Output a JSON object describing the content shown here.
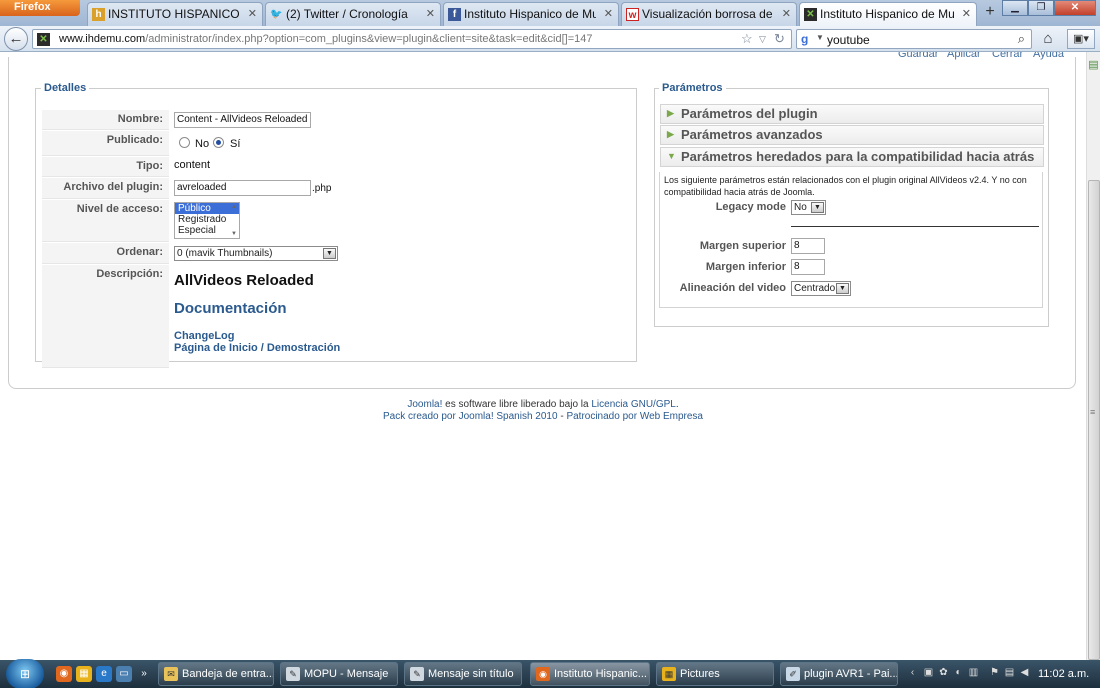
{
  "browser": {
    "app_button": "Firefox",
    "tabs": [
      {
        "label": "INSTITUTO HISPANICO DE M..."
      },
      {
        "label": "(2) Twitter / Cronología"
      },
      {
        "label": "Instituto Hispanico de Murcia"
      },
      {
        "label": "Visualización borrosa de vide..."
      },
      {
        "label": "Instituto Hispanico de Murci..."
      }
    ],
    "new_tab": "+",
    "url_host": "www.ihdemu.com",
    "url_path": "/administrator/index.php?option=com_plugins&view=plugin&client=site&task=edit&cid[]=147",
    "search_value": "youtube"
  },
  "toolbar": {
    "save": "Guardar",
    "apply": "Aplicar",
    "close": "Cerrar",
    "help": "Ayuda"
  },
  "detalles": {
    "legend": "Detalles",
    "name_label": "Nombre:",
    "name_value": "Content - AllVideos Reloaded",
    "published_label": "Publicado:",
    "published_no": "No",
    "published_yes": "Sí",
    "type_label": "Tipo:",
    "type_value": "content",
    "file_label": "Archivo del plugin:",
    "file_value": "avreloaded",
    "file_ext": ".php",
    "access_label": "Nivel de acceso:",
    "access_options": [
      "Público",
      "Registrado",
      "Especial"
    ],
    "order_label": "Ordenar:",
    "order_value": "0 (mavik Thumbnails)",
    "desc_label": "Descripción:",
    "desc_title": "AllVideos Reloaded",
    "desc_doc": "Documentación",
    "desc_changelog": "ChangeLog",
    "desc_home": "Página de Inicio / Demostración"
  },
  "parametros": {
    "legend": "Parámetros",
    "panel_plugin": "Parámetros del plugin",
    "panel_advanced": "Parámetros avanzados",
    "panel_legacy": "Parámetros heredados para la compatibilidad hacia atrás",
    "legacy_desc": "Los siguiente parámetros están relacionados con el plugin original AllVideos v2.4. Y no con compatibilidad hacia atrás de Joomla.",
    "legacy_mode_label": "Legacy mode",
    "legacy_mode_value": "No",
    "margin_top_label": "Margen superior",
    "margin_top_value": "8",
    "margin_bottom_label": "Margen inferior",
    "margin_bottom_value": "8",
    "align_label": "Alineación del video",
    "align_value": "Centrado"
  },
  "footer": {
    "joomla": "Joomla!",
    "line1_text": " es software libre liberado bajo la ",
    "license": "Licencia GNU/GPL",
    "line1_end": ".",
    "line2_pack": "Pack creado por Joomla! Spanish 2010",
    "line2_sep": " - ",
    "line2_sponsor": "Patrocinado por Web Empresa"
  },
  "taskbar": {
    "tasks": [
      {
        "label": "Bandeja de entra..."
      },
      {
        "label": "MOPU - Mensaje"
      },
      {
        "label": "Mensaje sin título"
      },
      {
        "label": "Instituto Hispanic..."
      },
      {
        "label": "Pictures"
      },
      {
        "label": "plugin AVR1 - Pai..."
      }
    ],
    "clock": "11:02 a.m."
  },
  "colors": {
    "link": "#2a5a8e",
    "label": "#555555",
    "selection": "#3b6ed6"
  }
}
